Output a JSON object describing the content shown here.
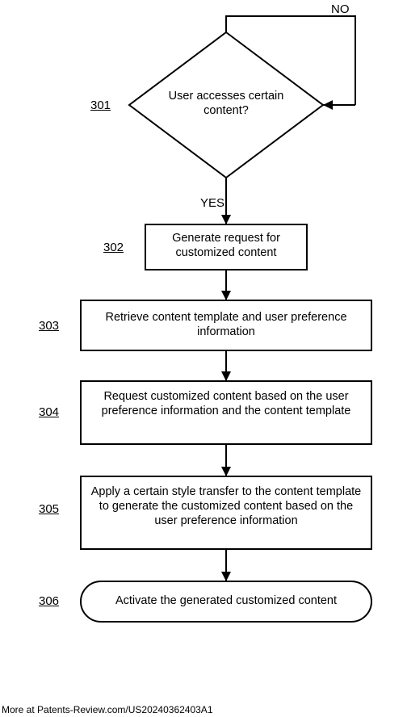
{
  "labels": {
    "no": "NO",
    "yes": "YES"
  },
  "steps": {
    "s301": {
      "num": "301",
      "text": "User accesses certain content?"
    },
    "s302": {
      "num": "302",
      "text": "Generate request for customized content"
    },
    "s303": {
      "num": "303",
      "text": "Retrieve content template and user preference information"
    },
    "s304": {
      "num": "304",
      "text": "Request customized content based on the user preference information and the content template"
    },
    "s305": {
      "num": "305",
      "text": "Apply a certain style transfer to the content template to generate the customized content based on the user preference information"
    },
    "s306": {
      "num": "306",
      "text": "Activate the generated customized content"
    }
  },
  "footer": "More at Patents-Review.com/US20240362403A1"
}
